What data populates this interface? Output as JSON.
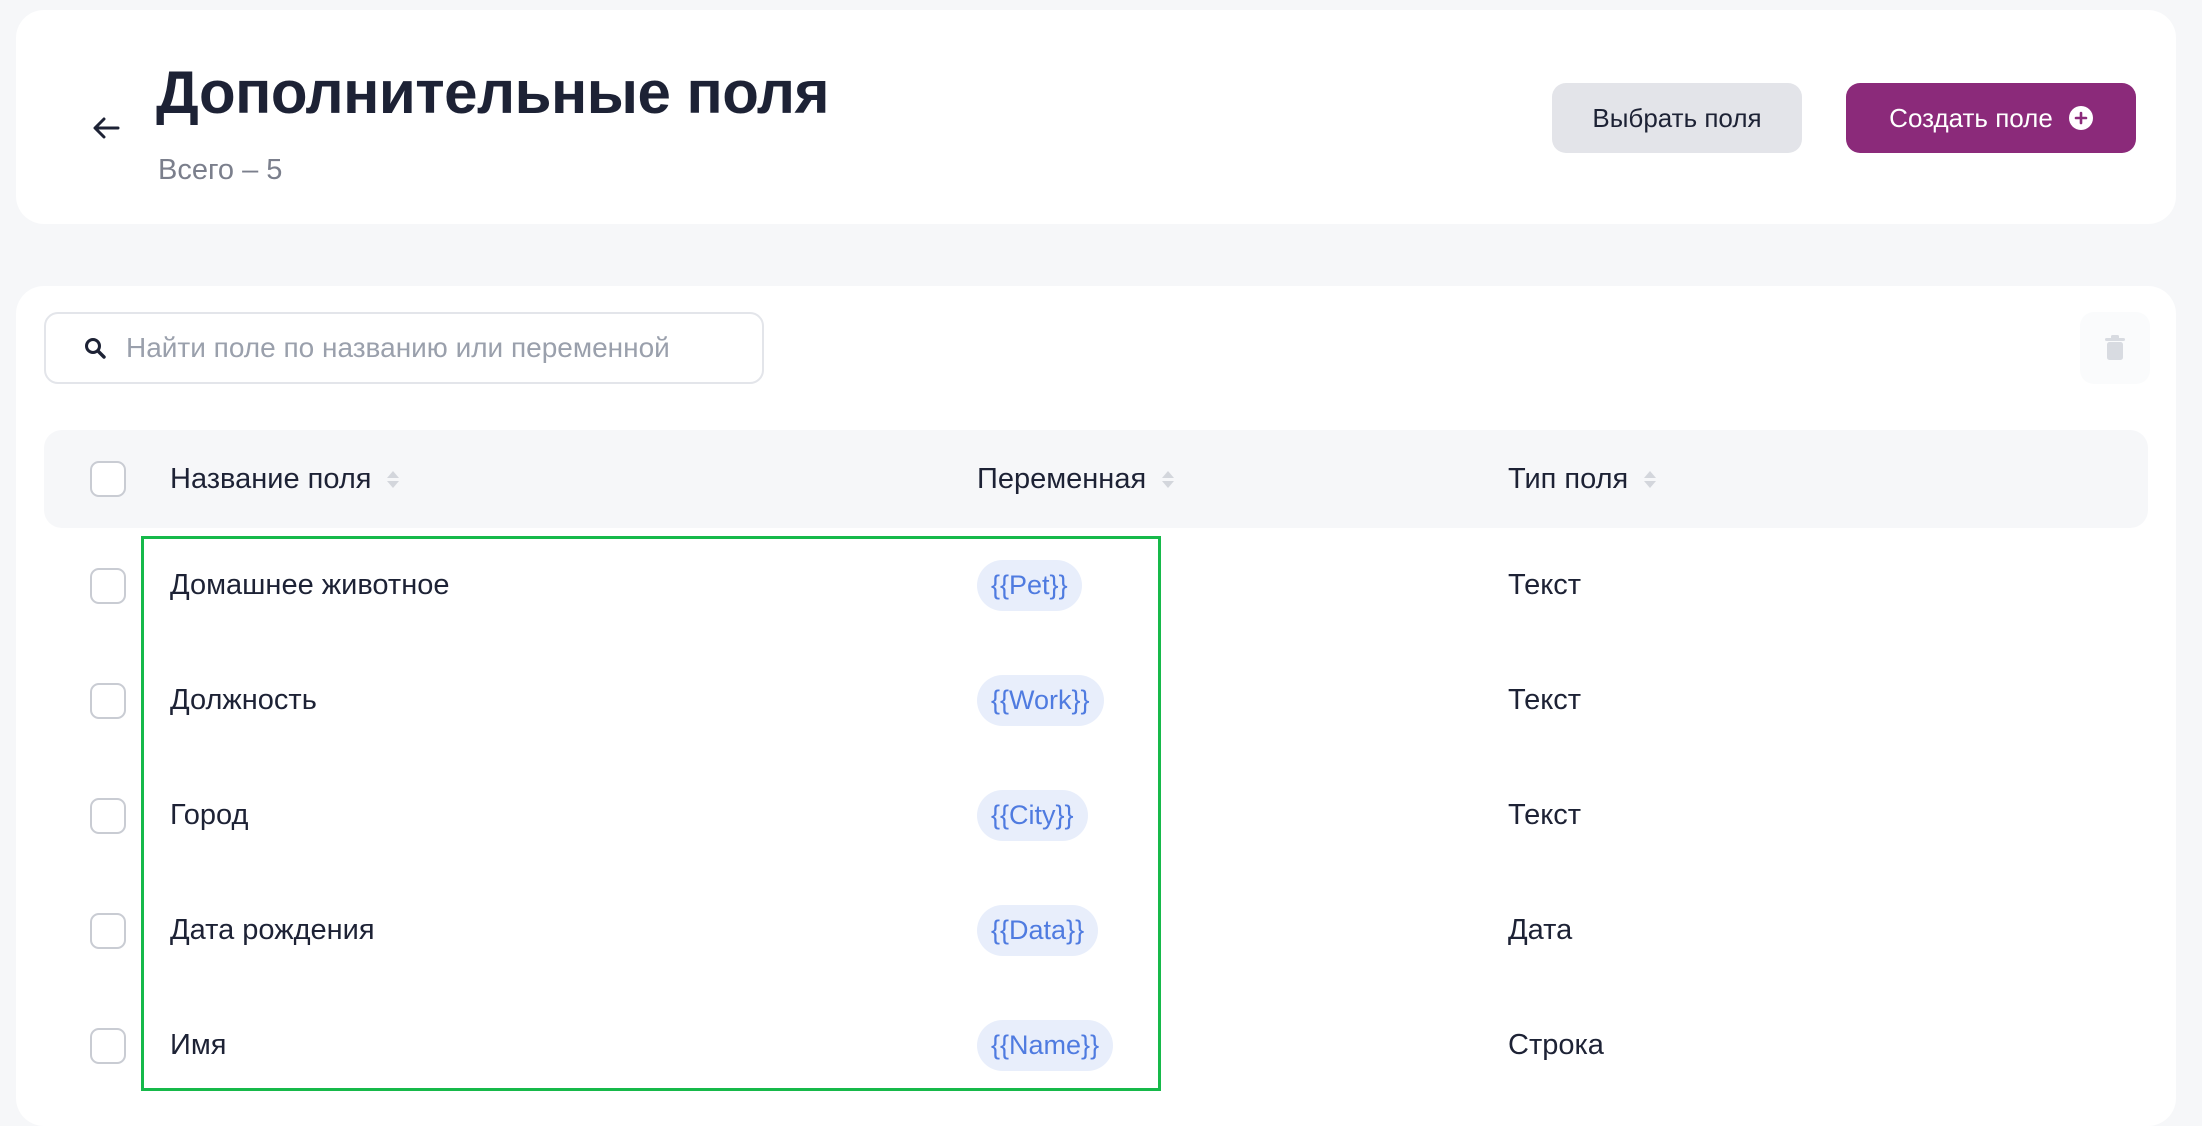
{
  "header": {
    "title": "Дополнительные поля",
    "subtitle": "Всего – 5",
    "select_fields_label": "Выбрать поля",
    "create_field_label": "Создать поле"
  },
  "search": {
    "placeholder": "Найти поле по названию или переменной",
    "value": ""
  },
  "table": {
    "columns": [
      "Название поля",
      "Переменная",
      "Тип поля"
    ],
    "rows": [
      {
        "name": "Домашнее животное",
        "variable": "{{Pet}}",
        "type": "Текст"
      },
      {
        "name": "Должность",
        "variable": "{{Work}}",
        "type": "Текст"
      },
      {
        "name": "Город",
        "variable": "{{City}}",
        "type": "Текст"
      },
      {
        "name": "Дата рождения",
        "variable": "{{Data}}",
        "type": "Дата"
      },
      {
        "name": "Имя",
        "variable": "{{Name}}",
        "type": "Строка"
      }
    ]
  },
  "colors": {
    "primary": "#8b2a7a",
    "variable_chip_bg": "#e8eefb",
    "variable_chip_text": "#4f7be0",
    "highlight": "#16b94a"
  },
  "icons": {
    "back": "arrow-left-icon",
    "create": "plus-circle-icon",
    "search": "search-icon",
    "delete": "trash-icon",
    "sort": "sort-icon"
  }
}
